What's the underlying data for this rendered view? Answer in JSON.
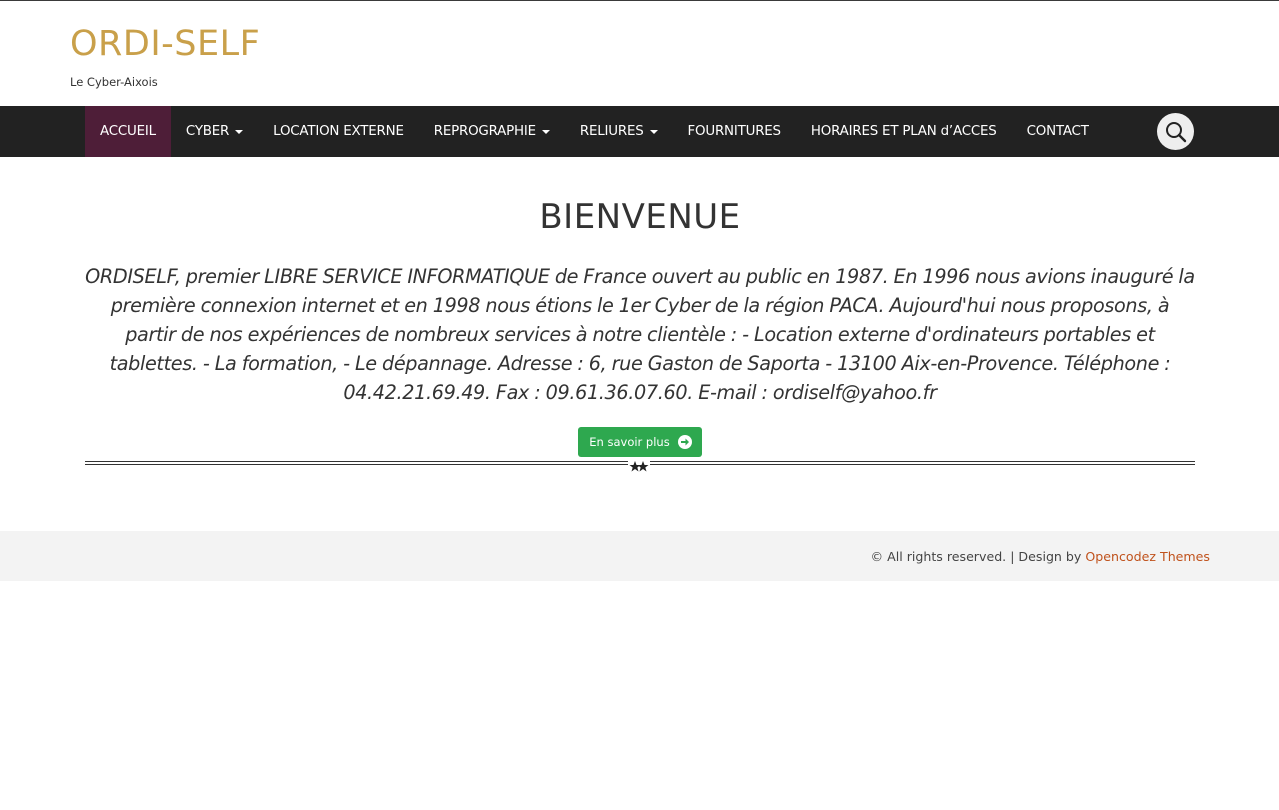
{
  "header": {
    "site_title": "ORDI-SELF",
    "tagline": "Le Cyber-Aixois"
  },
  "nav": {
    "items": [
      {
        "label": "ACCUEIL",
        "active": true,
        "dropdown": false
      },
      {
        "label": "CYBER",
        "active": false,
        "dropdown": true
      },
      {
        "label": "LOCATION EXTERNE",
        "active": false,
        "dropdown": false
      },
      {
        "label": "REPROGRAPHIE",
        "active": false,
        "dropdown": true
      },
      {
        "label": "RELIURES",
        "active": false,
        "dropdown": true
      },
      {
        "label": "FOURNITURES",
        "active": false,
        "dropdown": false
      },
      {
        "label": "HORAIRES ET PLAN d’ACCES",
        "active": false,
        "dropdown": false
      },
      {
        "label": "CONTACT",
        "active": false,
        "dropdown": false
      }
    ],
    "search_icon": "search-icon"
  },
  "main": {
    "title": "BIENVENUE",
    "text": "ORDISELF, premier LIBRE SERVICE INFORMATIQUE de France ouvert au public en 1987. En 1996 nous avions inauguré la première connexion internet et en 1998 nous étions le 1er Cyber de la région PACA. Aujourd'hui nous proposons, à partir de nos expériences de nombreux services à notre clientèle : - Location externe d'ordinateurs portables et tablettes. - La formation, - Le dépannage. Adresse : 6, rue Gaston de Saporta - 13100 Aix-en-Provence. Téléphone : 04.42.21.69.49. Fax : 09.61.36.07.60. E-mail : ordiself@yahoo.fr",
    "cta_label": "En savoir plus",
    "cta_icon": "arrow-right-icon"
  },
  "footer": {
    "copyright": "© All rights reserved. | Design by ",
    "link_text": "Opencodez Themes"
  },
  "colors": {
    "title_gold": "#c9a04a",
    "navbar_bg": "#222222",
    "nav_active_bg": "#4e1e38",
    "button_green": "#2ea84f",
    "footer_bg": "#f3f3f3",
    "footer_link": "#c0521c"
  }
}
